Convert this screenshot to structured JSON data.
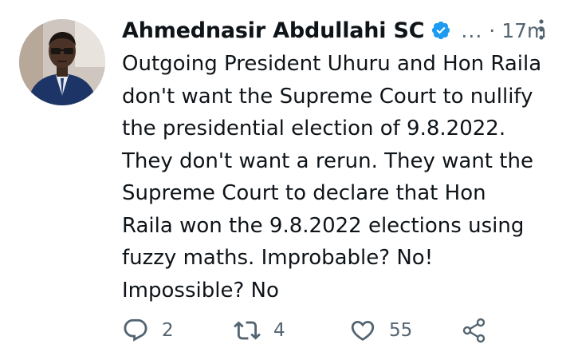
{
  "tweet": {
    "author_name": "Ahmednasir Abdullahi SC",
    "handle": "...",
    "separator": "·",
    "time": "17m",
    "text": "Outgoing President Uhuru and Hon Raila\ndon't want the Supreme Court  to nullify\nthe presidential election of 9.8.2022.\nThey don't want a rerun. They want the\nSupreme Court to declare that Hon\nRaila won the 9.8.2022 elections using\nfuzzy maths. Improbable? No!\nImpossible? No",
    "verified_badge": "verified-icon",
    "more_icon": "more-vertical-icon"
  },
  "actions": {
    "reply": {
      "icon": "reply-icon",
      "count": "2"
    },
    "retweet": {
      "icon": "retweet-icon",
      "count": "4"
    },
    "like": {
      "icon": "heart-icon",
      "count": "55"
    },
    "share": {
      "icon": "share-icon"
    }
  },
  "colors": {
    "text": "#0f1419",
    "secondary": "#536471",
    "verified": "#1d9bf0",
    "background": "#ffffff"
  }
}
